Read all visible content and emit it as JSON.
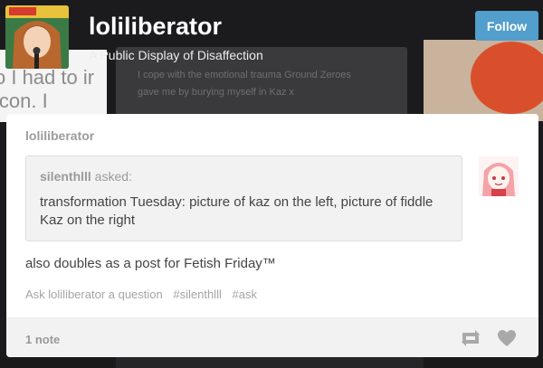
{
  "blog": {
    "title": "loliliberator",
    "description": "A Public Display of Disaffection",
    "follow_label": "Follow",
    "accent_color": "#529ecc"
  },
  "background": {
    "left_text": "o I had to ir icon. I",
    "tile_text": "I cope with the emotional trauma Ground Zeroes gave me by burying myself in Kaz x"
  },
  "post": {
    "author": "loliliberator",
    "ask": {
      "asker": "silenthlll",
      "asked_label": " asked:",
      "question": "transformation Tuesday: picture of kaz on the left, picture of fiddle Kaz on the right"
    },
    "body": "also doubles as a post for Fetish Friday™",
    "tags": [
      "Ask loliliberator a question",
      "#silenthlll",
      "#ask"
    ],
    "notes": "1 note",
    "icons": {
      "reblog": "reblog-icon",
      "like": "heart-icon"
    }
  }
}
